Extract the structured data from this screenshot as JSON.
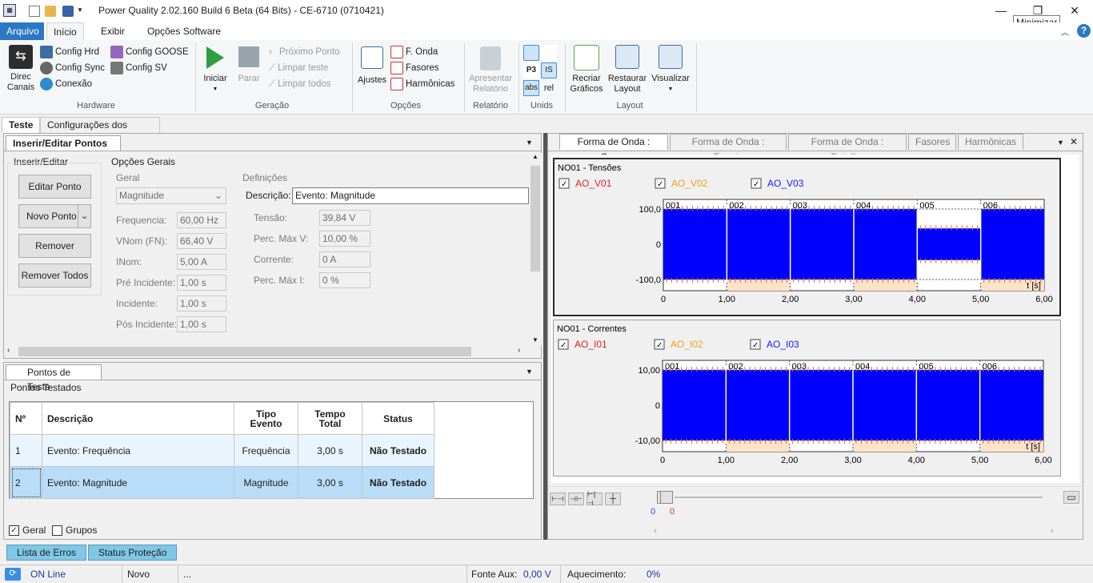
{
  "window": {
    "title": "Power Quality 2.02.160 Build 6 Beta (64 Bits) - CE-6710 (0710421)",
    "tooltip": "Minimizar",
    "minimize": "—",
    "maximize": "❐",
    "close": "✕"
  },
  "menu": {
    "file": "Arquivo",
    "tabs": [
      "Início",
      "Exibir",
      "Opções Software"
    ]
  },
  "ribbon": {
    "hardware": {
      "direc": "Direc\nCanais",
      "items": [
        "Config Hrd",
        "Config Sync",
        "Conexão",
        "Config GOOSE",
        "Config SV"
      ],
      "label": "Hardware"
    },
    "geracao": {
      "iniciar": "Iniciar",
      "parar": "Parar",
      "items": [
        "Próximo Ponto",
        "Limpar teste",
        "Limpar todos"
      ],
      "label": "Geração"
    },
    "opcoes": {
      "ajustes": "Ajustes",
      "items": [
        "F. Onda",
        "Fasores",
        "Harmônicas"
      ],
      "label": "Opções"
    },
    "relatorio": {
      "apresentar": "Apresentar\nRelatório",
      "label": "Relatório"
    },
    "unids": {
      "abs": "abs",
      "rel": "rel",
      "label": "Unids"
    },
    "layout": {
      "recriar": "Recriar\nGráficos",
      "restaurar": "Restaurar\nLayout",
      "visualizar": "Visualizar",
      "label": "Layout"
    }
  },
  "doctabs": [
    "Teste",
    "Configurações dos Testes"
  ],
  "editor": {
    "tab": "Inserir/Editar Pontos",
    "inserir": {
      "title": "Inserir/Editar",
      "buttons": [
        "Editar Ponto",
        "Novo Ponto",
        "Remover",
        "Remover Todos"
      ]
    },
    "opcoes_gerais": "Opções Gerais",
    "geral": {
      "title": "Geral",
      "select": "Magnitude",
      "fields": [
        {
          "label": "Frequencia:",
          "value": "60,00 Hz"
        },
        {
          "label": "VNom (FN):",
          "value": "66,40 V"
        },
        {
          "label": "INom:",
          "value": "5,00 A"
        },
        {
          "label": "Pré Incidente:",
          "value": "1,00 s"
        },
        {
          "label": "Incidente:",
          "value": "1,00 s"
        },
        {
          "label": "Pós Incidente:",
          "value": "1,00 s"
        }
      ]
    },
    "definicoes": {
      "title": "Definições",
      "desc_label": "Descrição:",
      "desc_value": "Evento: Magnitude",
      "fields": [
        {
          "label": "Tensão:",
          "value": "39,84 V"
        },
        {
          "label": "Perc. Máx V:",
          "value": "10,00 %"
        },
        {
          "label": "Corrente:",
          "value": "0 A"
        },
        {
          "label": "Perc. Máx I:",
          "value": "0 %"
        }
      ]
    }
  },
  "points": {
    "tab": "Pontos de Teste",
    "subtitle": "Pontos Testados",
    "headers": [
      "Nº",
      "Descrição",
      "Tipo\nEvento",
      "Tempo\nTotal",
      "Status"
    ],
    "rows": [
      [
        "1",
        "Evento: Frequência",
        "Frequência",
        "3,00 s",
        "Não Testado"
      ],
      [
        "2",
        "Evento: Magnitude",
        "Magnitude",
        "3,00 s",
        "Não Testado"
      ]
    ],
    "geral": "Geral",
    "grupos": "Grupos"
  },
  "bottomtabs": [
    "Lista de Erros",
    "Status Proteção"
  ],
  "wave": {
    "tabs": [
      "Forma de Onda : Grupo",
      "Forma de Onda : Evento",
      "Forma de Onda : Detalhe",
      "Fasores",
      "Harmônicas"
    ],
    "slider_left": "0",
    "slider_right": "0"
  },
  "chart_data": [
    {
      "type": "line",
      "title": "NO01 - Tensões",
      "series": [
        {
          "name": "AO_V01",
          "color": "#e02020"
        },
        {
          "name": "AO_V02",
          "color": "#e8a317"
        },
        {
          "name": "AO_V03",
          "color": "#1a1aff"
        }
      ],
      "ylim": [
        -100,
        100
      ],
      "yticks": [
        "100,0",
        "0",
        "-100,0"
      ],
      "xlim": [
        0,
        6
      ],
      "xticks": [
        "0",
        "1,00",
        "2,00",
        "3,00",
        "4,00",
        "5,00",
        "6,00"
      ],
      "xlabel": "t [s]",
      "segments": [
        "001",
        "002",
        "003",
        "004",
        "005",
        "006"
      ],
      "segment_amplitude": [
        1,
        1,
        1,
        1,
        0.45,
        1
      ]
    },
    {
      "type": "line",
      "title": "NO01 - Correntes",
      "series": [
        {
          "name": "AO_I01",
          "color": "#e02020"
        },
        {
          "name": "AO_I02",
          "color": "#e8a317"
        },
        {
          "name": "AO_I03",
          "color": "#1a1aff"
        }
      ],
      "ylim": [
        -10,
        10
      ],
      "yticks": [
        "10,00",
        "0",
        "-10,00"
      ],
      "xlim": [
        0,
        6
      ],
      "xticks": [
        "0",
        "1,00",
        "2,00",
        "3,00",
        "4,00",
        "5,00",
        "6,00"
      ],
      "xlabel": "t [s]",
      "segments": [
        "001",
        "002",
        "003",
        "004",
        "005",
        "006"
      ],
      "segment_amplitude": [
        1,
        1,
        1,
        1,
        1,
        1
      ]
    }
  ],
  "status": {
    "online": "ON Line",
    "novo": "Novo",
    "dots": "...",
    "fonte_label": "Fonte Aux:",
    "fonte_value": "0,00 V",
    "aquec_label": "Aquecimento:",
    "aquec_value": "0%"
  }
}
